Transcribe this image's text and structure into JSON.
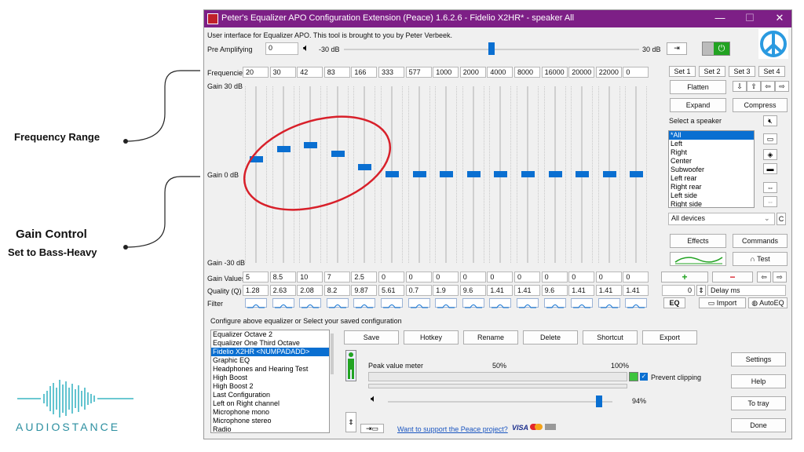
{
  "annotations": {
    "frequency_range": "Frequency Range",
    "gain_control": "Gain Control",
    "gain_control_sub": "Set to Bass-Heavy"
  },
  "brand": {
    "name": "AUDIOSTANCE"
  },
  "window": {
    "title": "Peter's Equalizer APO Configuration Extension (Peace) 1.6.2.6 - Fidelio X2HR* - speaker All",
    "controls": {
      "minimize": "—",
      "maximize": "☐",
      "close": "✕"
    },
    "subtitle": "User interface for Equalizer APO. This tool is brought to you by Peter Verbeek.",
    "pre_amp": {
      "label": "Pre Amplifying",
      "value": "0",
      "min_label": "-30 dB",
      "max_label": "30 dB",
      "level": 0.5
    },
    "labels": {
      "frequencies": "Frequencies",
      "gain_top": "Gain 30 dB",
      "gain_mid": "Gain 0 dB",
      "gain_bottom": "Gain -30 dB",
      "gain_values": "Gain Values",
      "quality": "Quality (Q)",
      "filter": "Filter"
    },
    "bands": {
      "frequencies": [
        "20",
        "30",
        "42",
        "83",
        "166",
        "333",
        "577",
        "1000",
        "2000",
        "4000",
        "8000",
        "16000",
        "20000",
        "22000",
        "0"
      ],
      "gains": [
        "5",
        "8.5",
        "10",
        "7",
        "2.5",
        "0",
        "0",
        "0",
        "0",
        "0",
        "0",
        "0",
        "0",
        "0",
        "0"
      ],
      "quality": [
        "1.28",
        "2.63",
        "2.08",
        "8.2",
        "9.87",
        "5.61",
        "0.7",
        "1.9",
        "9.6",
        "1.41",
        "1.41",
        "9.6",
        "1.41",
        "1.41",
        "1.41"
      ]
    },
    "right_panel": {
      "sets": [
        "Set 1",
        "Set 2",
        "Set 3",
        "Set 4"
      ],
      "flatten": "Flatten",
      "expand": "Expand",
      "compress": "Compress",
      "select_speaker": "Select a speaker",
      "speakers": [
        "*All",
        "Left",
        "Right",
        "Center",
        "Subwoofer",
        "Left rear",
        "Right rear",
        "Left side",
        "Right side"
      ],
      "devices": "All devices",
      "devices_c": "C",
      "effects": "Effects",
      "commands": "Commands",
      "test": "Test",
      "plus": "+",
      "minus": "−",
      "delay_value": "0",
      "delay_label": "Delay ms",
      "eq": "EQ",
      "import": "Import",
      "autoeq": "AutoEQ"
    },
    "config": {
      "label": "Configure above equalizer or Select your saved configuration",
      "items": [
        "Equalizer Octave 2",
        "Equalizer One Third Octave",
        "Fidelio X2HR <NUMPADADD>",
        "Graphic EQ",
        "Headphones and Hearing Test",
        "High Boost",
        "High Boost 2",
        "Last Configuration",
        "Left on Right channel",
        "Microphone mono",
        "Microphone stereo",
        "Radio"
      ],
      "buttons": [
        "Save",
        "Hotkey",
        "Rename",
        "Delete",
        "Shortcut",
        "Export"
      ]
    },
    "meter": {
      "label": "Peak value meter",
      "mid": "50%",
      "max": "100%",
      "prevent_clipping": "Prevent clipping",
      "volume": "94%",
      "volume_level": 0.94
    },
    "side_buttons": [
      "Settings",
      "Help",
      "To tray",
      "Done"
    ],
    "support_link": "Want to support the Peace project?",
    "payment": "VISA"
  }
}
